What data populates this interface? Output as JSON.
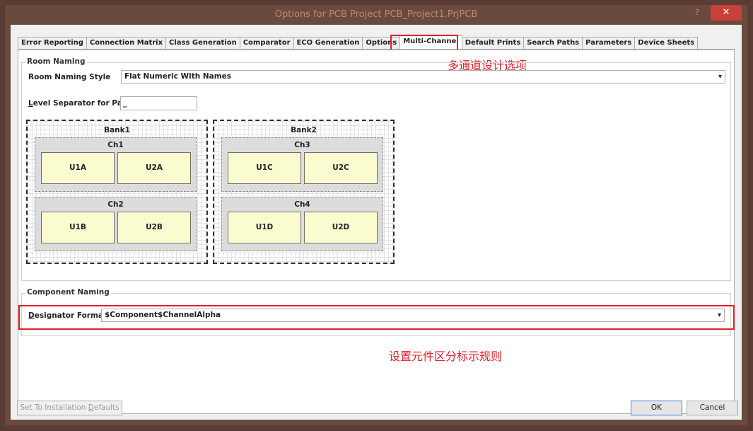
{
  "window": {
    "title": "Options for PCB Project PCB_Project1.PrjPCB",
    "help_label": "?",
    "close_label": "✕"
  },
  "tabs": [
    {
      "label": "Error Reporting"
    },
    {
      "label": "Connection Matrix"
    },
    {
      "label": "Class Generation"
    },
    {
      "label": "Comparator"
    },
    {
      "label": "ECO Generation"
    },
    {
      "label": "Options"
    },
    {
      "label": "Multi-Channel",
      "active": true
    },
    {
      "label": "Default Prints"
    },
    {
      "label": "Search Paths"
    },
    {
      "label": "Parameters"
    },
    {
      "label": "Device Sheets"
    }
  ],
  "annotations": {
    "tab_note": "多通道设计选项",
    "designator_note": "设置元件区分标示规则"
  },
  "room_naming": {
    "group_label": "Room Naming",
    "style_label": "Room Naming Style",
    "style_value": "Flat Numeric With Names",
    "separator_label_prefix": "L",
    "separator_label_rest": "evel Separator for Paths",
    "separator_value": "_"
  },
  "preview": {
    "banks": [
      {
        "title": "Bank1",
        "channels": [
          {
            "title": "Ch1",
            "components": [
              "U1A",
              "U2A"
            ]
          },
          {
            "title": "Ch2",
            "components": [
              "U1B",
              "U2B"
            ]
          }
        ]
      },
      {
        "title": "Bank2",
        "channels": [
          {
            "title": "Ch3",
            "components": [
              "U1C",
              "U2C"
            ]
          },
          {
            "title": "Ch4",
            "components": [
              "U1D",
              "U2D"
            ]
          }
        ]
      }
    ]
  },
  "component_naming": {
    "group_label": "Component Naming",
    "designator_label_prefix": "D",
    "designator_label_rest": "esignator Format",
    "designator_value": "$Component$ChannelAlpha"
  },
  "buttons": {
    "defaults_label_a": "Set To Installation ",
    "defaults_label_u": "D",
    "defaults_label_b": "efaults",
    "ok_label": "OK",
    "cancel_label": "Cancel"
  },
  "icons": {
    "dropdown": "chevron-down-icon",
    "close": "close-icon",
    "help": "help-icon"
  }
}
